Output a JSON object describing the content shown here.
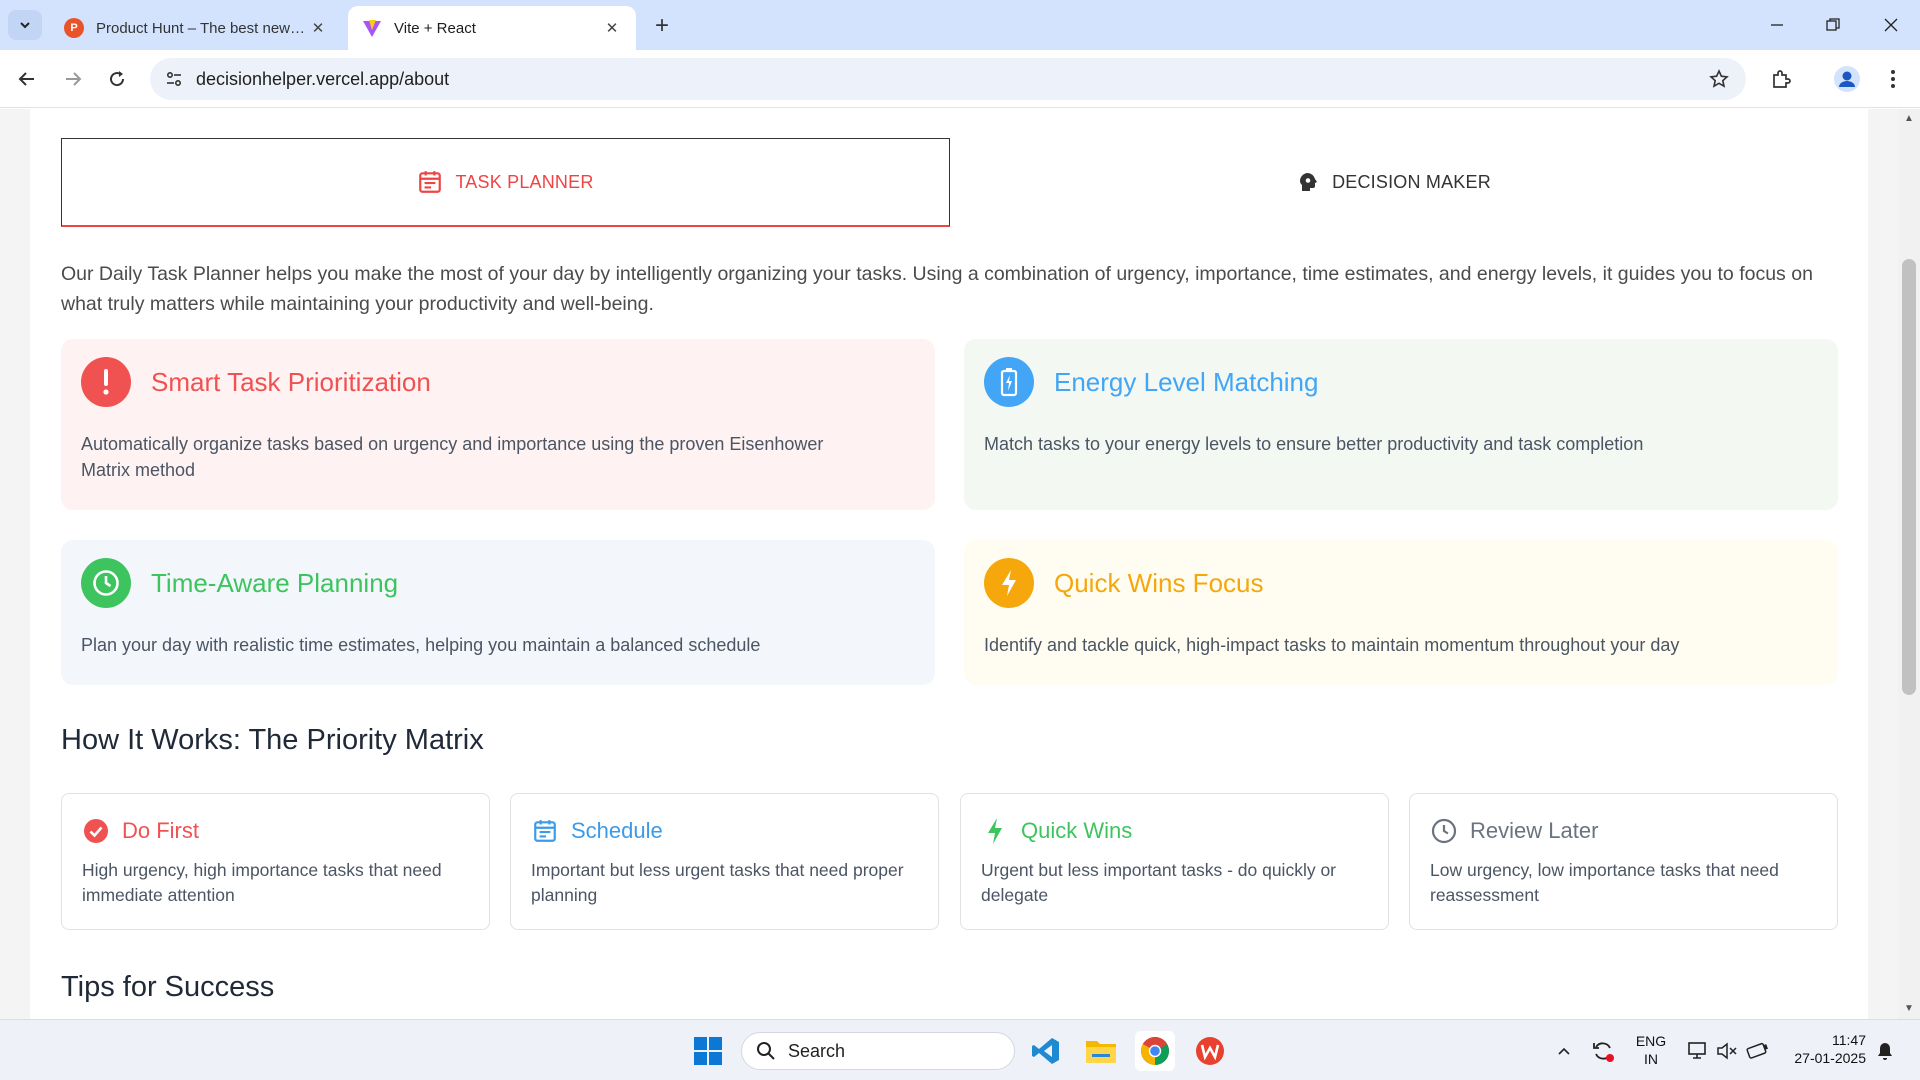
{
  "browser": {
    "tabs": [
      {
        "title": "Product Hunt – The best new products in tech",
        "favicon_letter": "P",
        "favicon_color": "#ea532a",
        "active": false
      },
      {
        "title": "Vite + React",
        "active": true
      }
    ],
    "url": "decisionhelper.vercel.app/about"
  },
  "mode_tabs": {
    "task_planner": "TASK PLANNER",
    "decision_maker": "DECISION MAKER"
  },
  "intro": "Our Daily Task Planner helps you make the most of your day by intelligently organizing your tasks. Using a combination of urgency, importance, time estimates, and energy levels, it guides you to focus on what truly matters while maintaining your productivity and well-being.",
  "features": [
    {
      "title": "Smart Task Prioritization",
      "desc": "Automatically organize tasks based on urgency and importance using the proven Eisenhower Matrix method",
      "color": "#f05252",
      "bg": "#fef2f2",
      "icon": "exclamation-icon"
    },
    {
      "title": "Energy Level Matching",
      "desc": "Match tasks to your energy levels to ensure better productivity and task completion",
      "color": "#42a5f5",
      "bg": "#f3f8f3",
      "icon": "battery-icon"
    },
    {
      "title": "Time-Aware Planning",
      "desc": "Plan your day with realistic time estimates, helping you maintain a balanced schedule",
      "color": "#3ec45f",
      "bg": "#f3f7fb",
      "icon": "clock-icon"
    },
    {
      "title": "Quick Wins Focus",
      "desc": "Identify and tackle quick, high-impact tasks to maintain momentum throughout your day",
      "color": "#f5a70b",
      "bg": "#fffdf1",
      "icon": "bolt-icon"
    }
  ],
  "matrix": {
    "title": "How It Works: The Priority Matrix",
    "cards": [
      {
        "title": "Do First",
        "desc": "High urgency, high importance tasks that need immediate attention",
        "color": "#f05252",
        "icon": "check-circle-icon"
      },
      {
        "title": "Schedule",
        "desc": "Important but less urgent tasks that need proper planning",
        "color": "#3b9be8",
        "icon": "calendar-icon"
      },
      {
        "title": "Quick Wins",
        "desc": "Urgent but less important tasks - do quickly or delegate",
        "color": "#3ec45f",
        "icon": "bolt-icon"
      },
      {
        "title": "Review Later",
        "desc": "Low urgency, low importance tasks that need reassessment",
        "color": "#6b7280",
        "icon": "clock-icon"
      }
    ]
  },
  "tips_title": "Tips for Success",
  "taskbar": {
    "search_label": "Search",
    "lang_top": "ENG",
    "lang_bottom": "IN",
    "time": "11:47",
    "date": "27-01-2025"
  }
}
